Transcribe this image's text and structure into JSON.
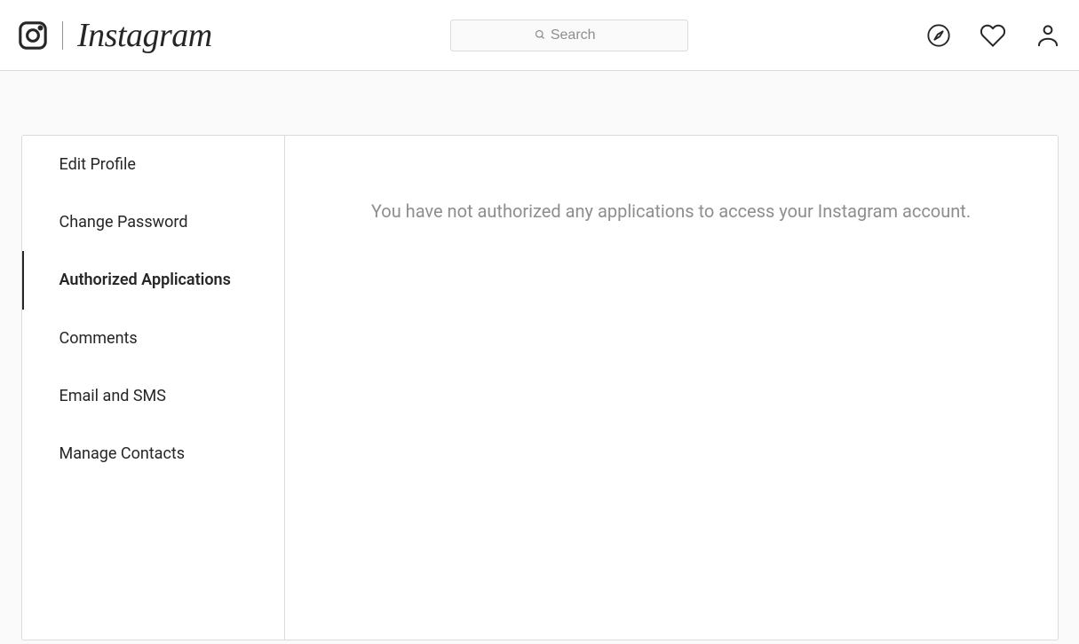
{
  "header": {
    "wordmark": "Instagram",
    "search": {
      "placeholder": "Search"
    }
  },
  "sidebar": {
    "items": [
      {
        "label": "Edit Profile",
        "active": false
      },
      {
        "label": "Change Password",
        "active": false
      },
      {
        "label": "Authorized Applications",
        "active": true
      },
      {
        "label": "Comments",
        "active": false
      },
      {
        "label": "Email and SMS",
        "active": false
      },
      {
        "label": "Manage Contacts",
        "active": false
      }
    ]
  },
  "main": {
    "empty_message": "You have not authorized any applications to access your Instagram account."
  }
}
